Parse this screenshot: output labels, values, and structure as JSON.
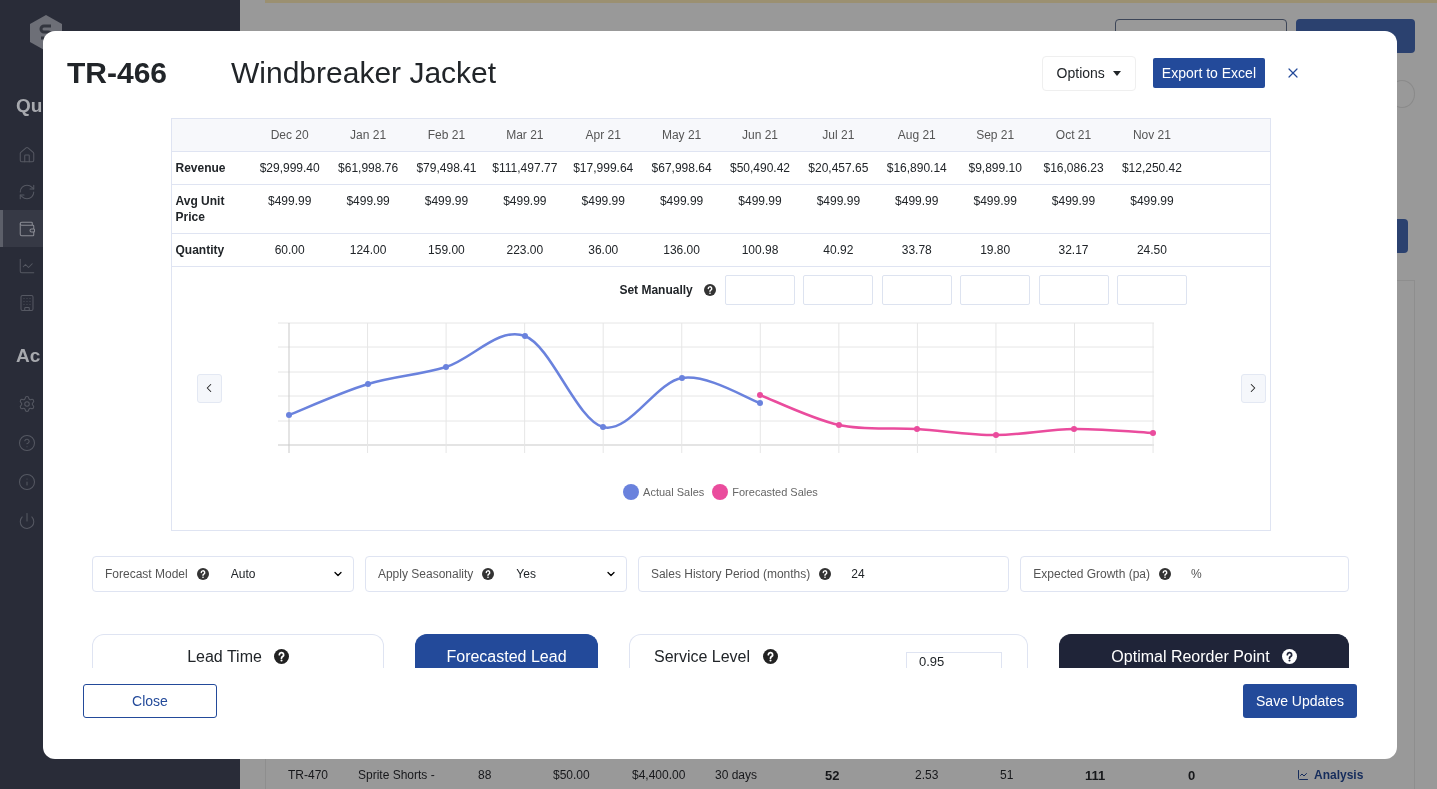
{
  "sidebar": {
    "sections": [
      {
        "heading": "Qu",
        "items": [
          {
            "selected": false
          },
          {
            "selected": false
          },
          {
            "selected": true
          },
          {
            "selected": false
          },
          {
            "selected": false
          }
        ]
      },
      {
        "heading": "Ac",
        "items": [
          {
            "selected": false
          },
          {
            "selected": false
          },
          {
            "selected": false
          },
          {
            "selected": false
          }
        ]
      }
    ]
  },
  "background_table_row": {
    "cells": [
      "TR-470",
      "Sprite Shorts -",
      "88",
      "$50.00",
      "$4,400.00",
      "30 days",
      "52",
      "2.53",
      "51",
      "111",
      "0"
    ],
    "link": "Analysis"
  },
  "modal": {
    "sku": "TR-466",
    "title": "Windbreaker Jacket",
    "options_button": "Options",
    "export_button": "Export to Excel",
    "table": {
      "columns": [
        {
          "label": "Dec 20",
          "manual_entry": false
        },
        {
          "label": "Jan 21",
          "manual_entry": false
        },
        {
          "label": "Feb 21",
          "manual_entry": false
        },
        {
          "label": "Mar 21",
          "manual_entry": false
        },
        {
          "label": "Apr 21",
          "manual_entry": false
        },
        {
          "label": "May 21",
          "manual_entry": false
        },
        {
          "label": "Jun 21",
          "manual_entry": true
        },
        {
          "label": "Jul 21",
          "manual_entry": true
        },
        {
          "label": "Aug 21",
          "manual_entry": true
        },
        {
          "label": "Sep 21",
          "manual_entry": true
        },
        {
          "label": "Oct 21",
          "manual_entry": true
        },
        {
          "label": "Nov 21",
          "manual_entry": true
        }
      ],
      "rows": [
        {
          "label": "Revenue",
          "values": [
            "$29,999.40",
            "$61,998.76",
            "$79,498.41",
            "$111,497.77",
            "$17,999.64",
            "$67,998.64",
            "$50,490.42",
            "$20,457.65",
            "$16,890.14",
            "$9,899.10",
            "$16,086.23",
            "$12,250.42"
          ]
        },
        {
          "label": "Avg Unit Price",
          "values": [
            "$499.99",
            "$499.99",
            "$499.99",
            "$499.99",
            "$499.99",
            "$499.99",
            "$499.99",
            "$499.99",
            "$499.99",
            "$499.99",
            "$499.99",
            "$499.99"
          ]
        },
        {
          "label": "Quantity",
          "values": [
            "60.00",
            "124.00",
            "159.00",
            "223.00",
            "36.00",
            "136.00",
            "100.98",
            "40.92",
            "33.78",
            "19.80",
            "32.17",
            "24.50"
          ]
        }
      ],
      "set_manually_label": "Set Manually"
    },
    "chart": {
      "legend": [
        {
          "label": "Actual Sales",
          "color": "#6a82dd"
        },
        {
          "label": "Forecasted Sales",
          "color": "#ea4c9d"
        }
      ]
    },
    "settings": [
      {
        "kind": "select",
        "label": "Forecast Model",
        "value": "Auto"
      },
      {
        "kind": "select",
        "label": "Apply Seasonality",
        "value": "Yes"
      },
      {
        "kind": "input",
        "label": "Sales History Period (months)",
        "value": "24"
      },
      {
        "kind": "input",
        "label": "Expected Growth (pa)",
        "placeholder": "%"
      }
    ],
    "cards": [
      {
        "kind": "plain",
        "title": "Lead Time",
        "help": true
      },
      {
        "kind": "primary",
        "title": "Forecasted Lead",
        "help": false
      },
      {
        "kind": "input",
        "title": "Service Level",
        "help": true,
        "value": "0.95"
      },
      {
        "kind": "dark",
        "title": "Optimal Reorder Point",
        "help": true
      }
    ],
    "footer": {
      "close_button": "Close",
      "save_button": "Save Updates"
    }
  }
}
